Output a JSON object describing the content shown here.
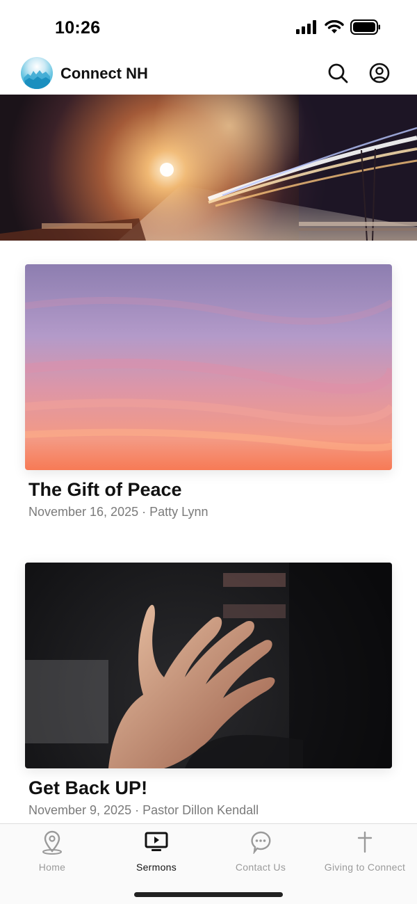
{
  "status_bar": {
    "time": "10:26",
    "icons": [
      "signal-icon",
      "wifi-icon",
      "battery-icon"
    ]
  },
  "header": {
    "app_name": "Connect NH",
    "logo_icon": "church-logo-icon",
    "actions": [
      {
        "name": "search",
        "icon": "search-icon"
      },
      {
        "name": "profile",
        "icon": "user-circle-icon"
      }
    ]
  },
  "banner": {
    "image": "night-highway-light-trails"
  },
  "sermons": [
    {
      "title": "The Gift of Peace",
      "date": "November 16, 2025",
      "speaker": "Patty Lynn",
      "separator": "·",
      "image": "sunset-sky-clouds"
    },
    {
      "title": "Get Back UP!",
      "date": "November 9, 2025",
      "speaker": "Pastor Dillon Kendall",
      "separator": "·",
      "image": "open-hand-reaching"
    }
  ],
  "tab_bar": {
    "tabs": [
      {
        "label": "Home",
        "icon": "location-pin-icon",
        "active": false
      },
      {
        "label": "Sermons",
        "icon": "tv-play-icon",
        "active": true
      },
      {
        "label": "Contact Us",
        "icon": "chat-bubble-icon",
        "active": false
      },
      {
        "label": "Giving to Connect",
        "icon": "cross-icon",
        "active": false
      }
    ]
  },
  "colors": {
    "text_primary": "#111111",
    "text_secondary": "#7a7a7a",
    "tab_inactive": "#9a9a9a",
    "tab_active": "#111111",
    "tab_bar_bg": "#fafafa"
  }
}
